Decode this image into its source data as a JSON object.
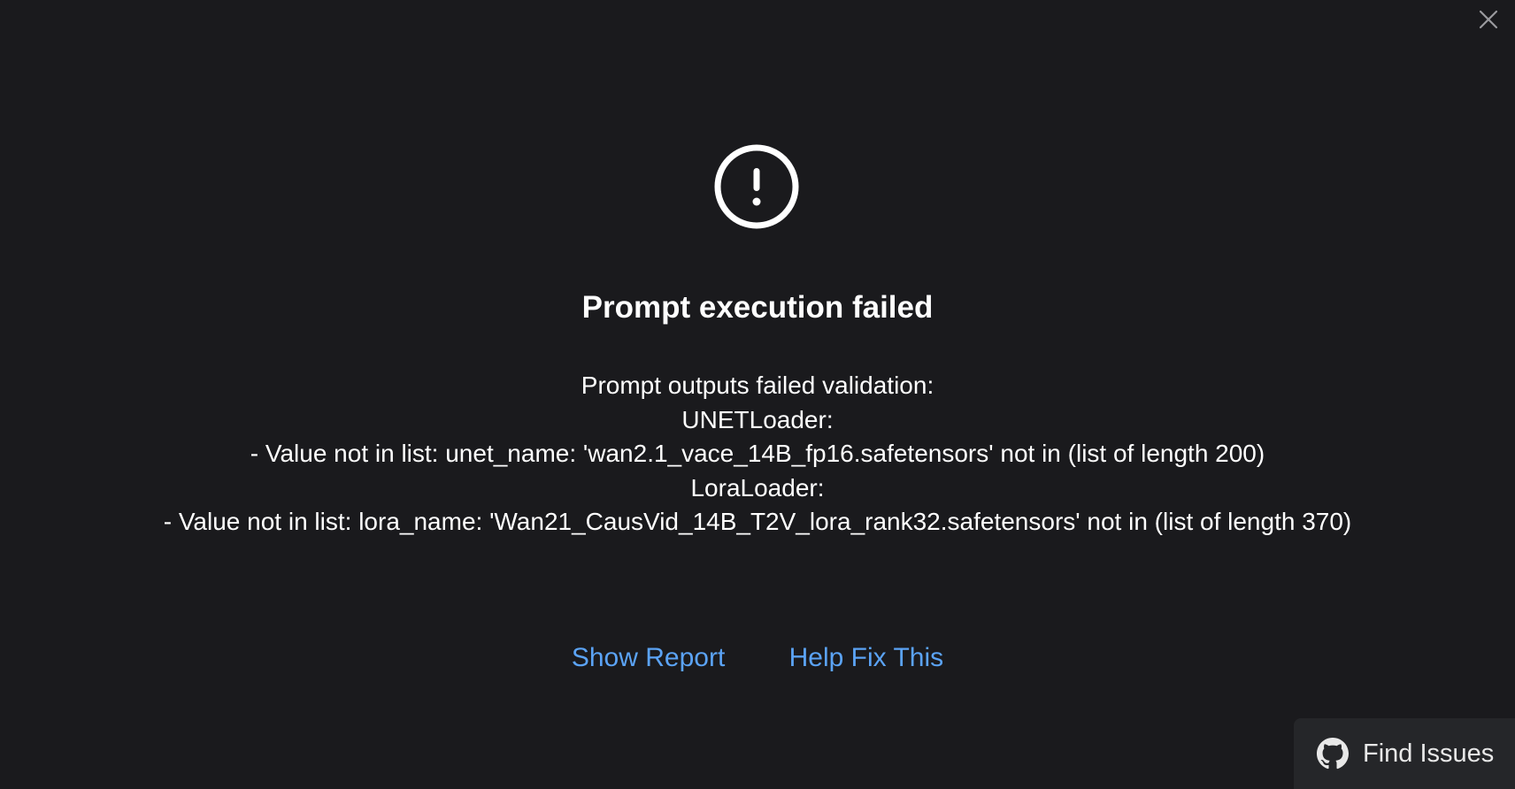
{
  "dialog": {
    "title": "Prompt execution failed",
    "message_lines": [
      "Prompt outputs failed validation:",
      "UNETLoader:",
      "- Value not in list: unet_name: 'wan2.1_vace_14B_fp16.safetensors' not in (list of length 200)",
      "LoraLoader:",
      "- Value not in list: lora_name: 'Wan21_CausVid_14B_T2V_lora_rank32.safetensors' not in (list of length 370)"
    ],
    "actions": {
      "show_report": "Show Report",
      "help_fix": "Help Fix This"
    },
    "icons": {
      "status": "exclamation-circle-icon",
      "close": "close-icon"
    }
  },
  "footer": {
    "find_issues_label": "Find Issues",
    "icon": "github-icon"
  },
  "colors": {
    "background": "#1a1a1d",
    "link": "#5ba3f5",
    "text": "#ffffff",
    "button_bg": "#252629"
  }
}
